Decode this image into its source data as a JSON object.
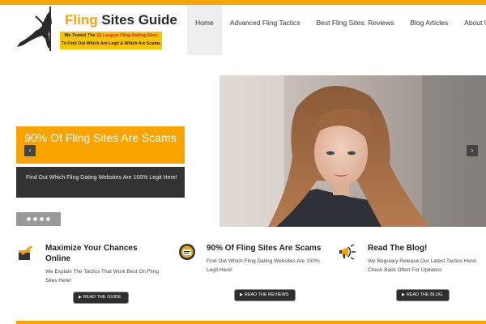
{
  "header": {
    "logo_title_part1": "Fling",
    "logo_title_part2": "Sites Guide",
    "logo_badge_line1_pre": "We Tested The",
    "logo_badge_line1_hl": "15 Largest Fling Dating Sites",
    "logo_badge_line2": "To Find Out Which Are Legit & Which Are Scams"
  },
  "nav": {
    "items": [
      {
        "label": "Home",
        "active": true
      },
      {
        "label": "Advanced Fling Tactics",
        "active": false
      },
      {
        "label": "Best Fling Sites: Reviews",
        "active": false
      },
      {
        "label": "Blog Articles",
        "active": false
      },
      {
        "label": "About Us",
        "active": false
      }
    ]
  },
  "slider": {
    "title": "90% Of Fling Sites Are Scams",
    "description": "Find Out Which Fling Dating Websites Are 100% Legit Here!",
    "prev_icon": "‹",
    "next_icon": "›",
    "dot_count": 4
  },
  "features": [
    {
      "title_line1": "Maximize Your Chances",
      "title_line2": "Online",
      "text": "We Explain The Tactics That Work Best On Fling Sites Here!",
      "button": "READ THE GUIDE"
    },
    {
      "title_line1": "90% Of Fling Sites Are Scams",
      "title_line2": "",
      "text": "Find Out Which Fling Dating Websites Are 100% Legit Here!",
      "button": "READ THE REVIEWS"
    },
    {
      "title_line1": "Read The Blog!",
      "title_line2": "",
      "text": "We Regulary Release Our Latest Tactics Here! Check Back Often For Updates!",
      "button": "READ THE BLOG"
    }
  ],
  "colors": {
    "accent": "#f8a300",
    "dark_box": "#333333",
    "nav_active_bg": "#eeeeee"
  }
}
